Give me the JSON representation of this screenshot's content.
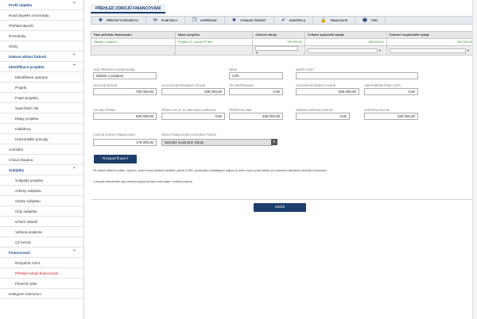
{
  "sidebar": {
    "items": [
      {
        "label": "Profil objektu",
        "kind": "header"
      },
      {
        "label": "Nová depeše a koncepty",
        "kind": "item"
      },
      {
        "label": "Přehled depeší",
        "kind": "item"
      },
      {
        "label": "Poznámky",
        "kind": "item"
      },
      {
        "label": "Úkoly",
        "kind": "item"
      },
      {
        "label": "Datová oblast žádosti",
        "kind": "header"
      },
      {
        "label": "Identifikace projektu",
        "kind": "header"
      },
      {
        "label": "Identifikace operace",
        "kind": "sub"
      },
      {
        "label": "Projekt",
        "kind": "sub"
      },
      {
        "label": "Popis projektu",
        "kind": "sub"
      },
      {
        "label": "Specifické cíle",
        "kind": "sub"
      },
      {
        "label": "Etapy projektu",
        "kind": "sub"
      },
      {
        "label": "Indikátory",
        "kind": "sub"
      },
      {
        "label": "Horizontální principy",
        "kind": "sub"
      },
      {
        "label": "Umístění",
        "kind": "item"
      },
      {
        "label": "Cílová skupina",
        "kind": "item"
      },
      {
        "label": "Subjekty",
        "kind": "header"
      },
      {
        "label": "Subjekty projektu",
        "kind": "sub"
      },
      {
        "label": "Adresy subjektu",
        "kind": "sub"
      },
      {
        "label": "Osoby subjektu",
        "kind": "sub"
      },
      {
        "label": "Účty subjektu",
        "kind": "sub"
      },
      {
        "label": "Účetní období",
        "kind": "sub"
      },
      {
        "label": "Veřejná podpora",
        "kind": "sub"
      },
      {
        "label": "CZ NACE",
        "kind": "sub"
      },
      {
        "label": "Financování",
        "kind": "header"
      },
      {
        "label": "Rozpočet roční",
        "kind": "sub"
      },
      {
        "label": "Přehled zdrojů financování",
        "kind": "active"
      },
      {
        "label": "Finanční plán",
        "kind": "sub"
      },
      {
        "label": "Kategorie intervencí",
        "kind": "item"
      }
    ],
    "chevron": "chevron-up-icon"
  },
  "page": {
    "title": "PŘEHLED ZDROJŮ FINANCOVÁNÍ"
  },
  "toolbar": {
    "buttons": [
      {
        "label": "PŘÍSTUP K PROJEKTU",
        "icon": "✱"
      },
      {
        "label": "PLNÉ MOCI",
        "icon": "✉"
      },
      {
        "label": "KOPÍROVAT",
        "icon": "❐"
      },
      {
        "label": "VYMAZAT ŽÁDOST",
        "icon": "✖"
      },
      {
        "label": "KONTROLA",
        "icon": "✔"
      },
      {
        "label": "FINALIZACE",
        "icon": "🔒"
      },
      {
        "label": "TISK",
        "icon": "🖶"
      }
    ]
  },
  "table": {
    "headers": [
      "Fáze přehledu financování",
      "Název projektu",
      "Celkové zdroje",
      "Celkové způsobilé výdaje",
      "Celkové nezpůsobilé výdaje"
    ],
    "row": [
      "Žádost o podporu",
      "Projekt 2.5. výzva VP test",
      "700 000,00",
      "500 000,00",
      "200 000,00"
    ]
  },
  "form": {
    "faze_label": "Fáze přehledu financování",
    "faze_value": "Žádost o podporu",
    "mena_label": "Měna",
    "mena_value": "CZK",
    "nazev_etapy_label": "Název etapy",
    "nazev_etapy_value": "",
    "celkove_zdroje_label": "Celkové zdroje",
    "celkove_zdroje_value": "700 000,00",
    "celkove_nezp_label": "Celkové nezpůsobilé výdaje",
    "celkove_nezp_value": "200 000,00",
    "jpv_nezp_label": "JPV nezpůsobilé",
    "jpv_nezp_value": "0,00",
    "celkove_zpus_label": "Celkové způsobilé výdaje",
    "celkove_zpus_value": "500 000,00",
    "jine_penezni_label": "Jiné peněžní příjmy (JPP)",
    "jine_penezni_value": "0,00",
    "czv_bez_label": "CZV bez příjmů",
    "czv_bez_value": "500 000,00",
    "prijmy_label": "Příjmy dle čl. 61 obecného nařízení",
    "prijmy_value": "0,00",
    "prispevek_label": "Příspěvek Unie",
    "prispevek_value": "325 000,00",
    "narodni_label": "Národní veřejné zdroje",
    "narodni_value": "0,00",
    "podpora_label": "Podpora celkem",
    "podpora_value": "325 000,00",
    "vlastni_label": "Vlastní zdroje financování",
    "vlastni_value": "175 000,00",
    "zdroj_label": "Zdroj financování vlastního podílu",
    "zdroj_value": "Národní soukromé zdroje"
  },
  "actions": {
    "rozpad": "Rozpad financí",
    "ulozit": "Uložit"
  },
  "info": {
    "line1": "Při změně vlastního podílu, rozpočtu, právní formy klientské žadatele, příjmů a CBA, specifických cílů/kategorií regionu je nutné znovu použít tlačítko pro zobrazení aktuálního přehledu financování.",
    "line2": "V případě relevantního typu veřejné podpory je třeba začít údaje o veřejné podpoře."
  }
}
